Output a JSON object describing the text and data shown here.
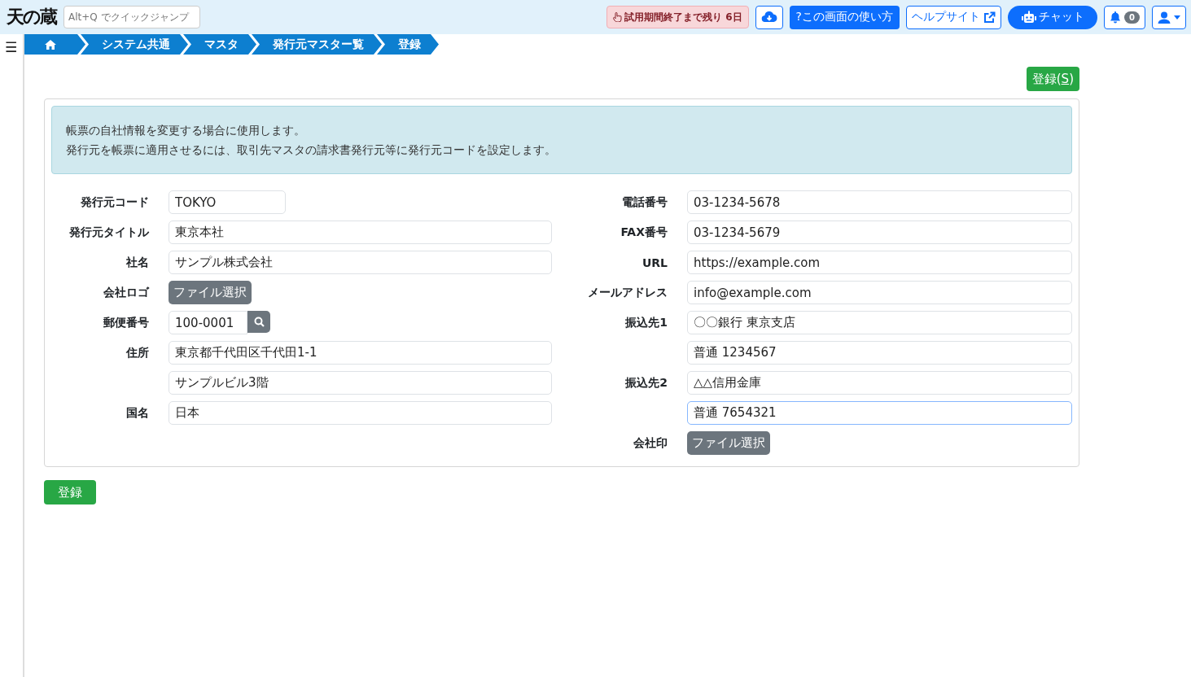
{
  "header": {
    "logo": "天の蔵",
    "quick_jump": {
      "placeholder": "Alt+Q でクイックジャンプ"
    },
    "trial_badge": "試用期間終了まで残り 6日",
    "usage_button": "?この画面の使い方",
    "help_button": "ヘルプサイト",
    "chat_button": "チャット",
    "notification_count": "0"
  },
  "sidebar": {
    "menu_glyph": "☰"
  },
  "breadcrumb": [
    "システム共通",
    "マスタ",
    "発行元マスター覧",
    "登録"
  ],
  "top_button": {
    "label": "登録(",
    "shortcut": "S",
    "label_end": ")"
  },
  "alert": [
    "帳票の自社情報を変更する場合に使用します。",
    "発行元を帳票に適用させるには、取引先マスタの請求書発行元等に発行元コードを設定します。"
  ],
  "left_fields": [
    {
      "label": "発行元コード",
      "kind": "short",
      "value": "TOKYO",
      "focused": false
    },
    {
      "label": "発行元タイトル",
      "kind": "text",
      "value": "東京本社",
      "focused": false
    },
    {
      "label": "社名",
      "kind": "text",
      "value": "サンプル株式会社",
      "focused": false
    },
    {
      "label": "会社ロゴ",
      "kind": "file",
      "value": "ファイル選択"
    },
    {
      "label": "郵便番号",
      "kind": "zip",
      "value": "100-0001",
      "focused": false
    },
    {
      "label": "住所",
      "kind": "text",
      "value": "東京都千代田区千代田1-1",
      "focused": false
    },
    {
      "kind": "text",
      "value": "サンプルビル3階",
      "focused": false
    },
    {
      "label": "国名",
      "kind": "text",
      "value": "日本",
      "focused": false
    }
  ],
  "right_fields": [
    {
      "label": "電話番号",
      "kind": "text",
      "value": "03-1234-5678",
      "focused": false
    },
    {
      "label": "FAX番号",
      "kind": "text",
      "value": "03-1234-5679",
      "focused": false
    },
    {
      "label": "URL",
      "kind": "text",
      "value": "https://example.com",
      "focused": false
    },
    {
      "label": "メールアドレス",
      "kind": "text",
      "value": "info@example.com",
      "focused": false
    },
    {
      "label": "振込先1",
      "kind": "text",
      "value": "〇〇銀行 東京支店",
      "focused": false
    },
    {
      "kind": "text",
      "value": "普通 1234567",
      "focused": false
    },
    {
      "label": "振込先2",
      "kind": "text",
      "value": "△△信用金庫",
      "focused": false
    },
    {
      "kind": "text",
      "value": "普通 7654321",
      "focused": true
    },
    {
      "label": "会社印",
      "kind": "file",
      "value": "ファイル選択"
    }
  ],
  "bottom_button": "登録"
}
